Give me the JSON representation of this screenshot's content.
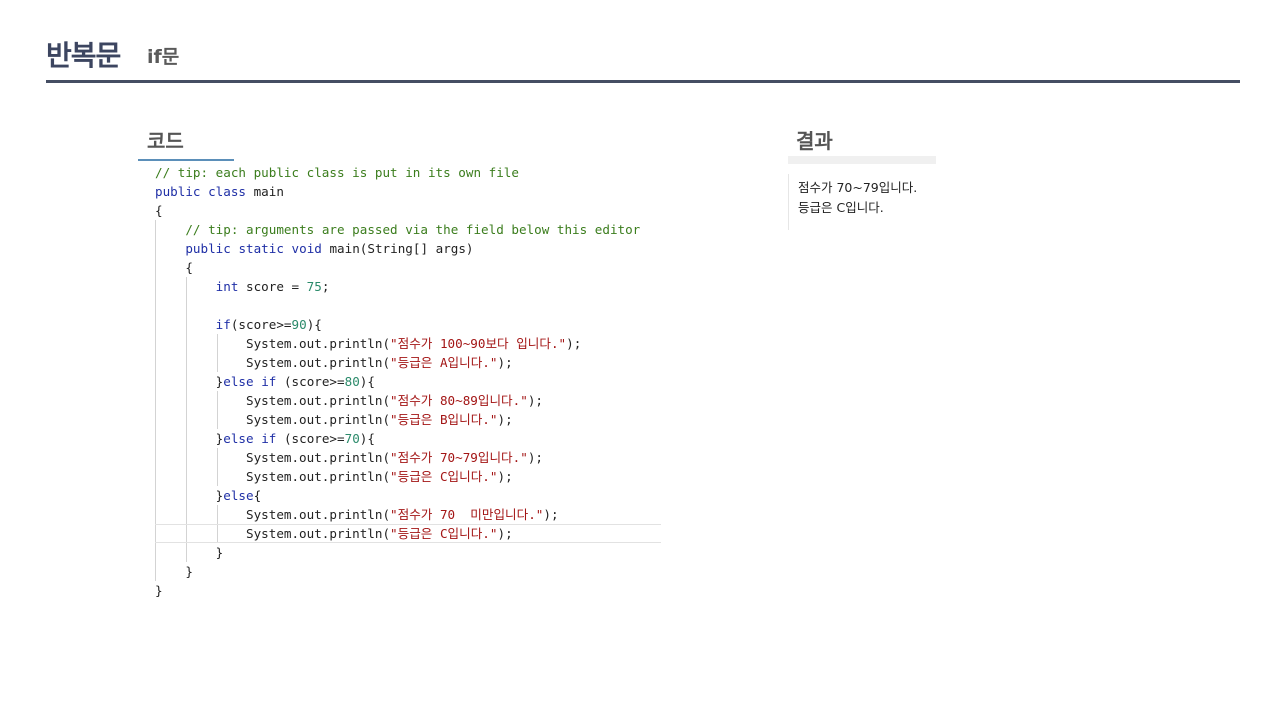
{
  "header": {
    "title": "반복문",
    "subtitle": "if문"
  },
  "code_section": {
    "label": "코드",
    "lines": [
      "// tip: each public class is put in its own file",
      "public class main",
      "{",
      "    // tip: arguments are passed via the field below this editor",
      "    public static void main(String[] args)",
      "    {",
      "        int score = 75;",
      "",
      "        if(score>=90){",
      "            System.out.println(\"점수가 100~90보다 입니다.\");",
      "            System.out.println(\"등급은 A입니다.\");",
      "        }else if (score>=80){",
      "            System.out.println(\"점수가 80~89입니다.\");",
      "            System.out.println(\"등급은 B입니다.\");",
      "        }else if (score>=70){",
      "            System.out.println(\"점수가 70~79입니다.\");",
      "            System.out.println(\"등급은 C입니다.\");",
      "        }else{",
      "            System.out.println(\"점수가 70  미만입니다.\");",
      "            System.out.println(\"등급은 C입니다.\");",
      "        }",
      "    }",
      "}"
    ],
    "highlighted_line": 19
  },
  "result_section": {
    "label": "결과",
    "output_lines": [
      "점수가 70~79입니다.",
      "등급은 C입니다."
    ]
  },
  "colors": {
    "comment": "#3b7d1d",
    "keyword": "#1f2fa6",
    "number": "#2a8a6a",
    "string": "#a31515",
    "header_rule": "#454e63",
    "accent_underline": "#5b8fb9"
  }
}
